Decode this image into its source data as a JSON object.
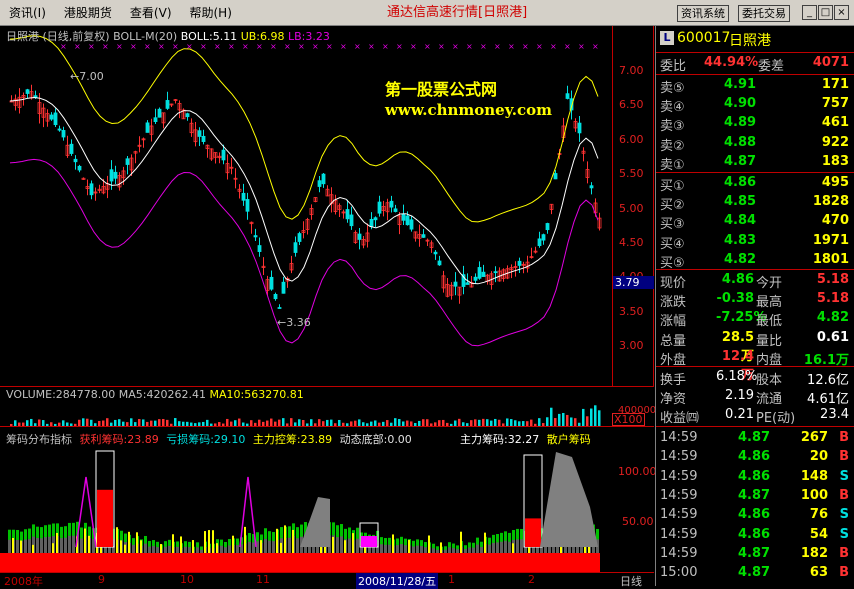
{
  "menu": [
    "资讯(I)",
    "港股期货",
    "查看(V)",
    "帮助(H)"
  ],
  "app_title": "通达信高速行情[日照港]",
  "sys_buttons": [
    "资讯系统",
    "委托交易"
  ],
  "window_buttons": [
    "_",
    "□",
    "×"
  ],
  "main_legend": {
    "name": "日照港",
    "mode": "(日线,前复权)",
    "indicator": "BOLL-M(20)",
    "boll": "BOLL:5.11",
    "ub": "UB:6.98",
    "lb": "LB:3.23"
  },
  "price_axis": [
    "7.00",
    "6.50",
    "6.00",
    "5.50",
    "5.00",
    "4.50",
    "4.00",
    "3.50",
    "3.00"
  ],
  "current_price_tag": "3.79",
  "annotations": {
    "high": "7.00",
    "low": "3.36"
  },
  "watermark": {
    "line1": "第一股票公式网",
    "line2": "www.chnmoney.com"
  },
  "vol_legend": {
    "vol": "VOLUME:284778.00",
    "ma5": "MA5:420262.41",
    "ma10": "MA10:563270.81"
  },
  "vol_axis": {
    "top": "400000",
    "unit": "X100"
  },
  "chip_legend": {
    "title": "筹码分布指标",
    "profit": "获利筹码:23.89",
    "loss": "亏损筹码:29.10",
    "control": "主力控筹:23.89",
    "bottom": "动态底部:0.00",
    "main": "主力筹码:32.27",
    "retail": "散户筹码"
  },
  "chip_axis": [
    "100.00",
    "50.00"
  ],
  "dates": [
    "2008年",
    "9",
    "10",
    "11",
    "2008/11/28/五",
    "1",
    "2"
  ],
  "period": "日线",
  "colors": {
    "up": "#ff3232",
    "down": "#00e0e0",
    "yellow": "#ffff00",
    "magenta": "#e000e0",
    "white": "#ffffff",
    "green": "#00e000",
    "axis_red": "#c00000"
  },
  "quote": {
    "code": "600017",
    "name": "日照港",
    "webi_label": "委比",
    "webi": "44.94%",
    "wecha_label": "委差",
    "wecha": "4071",
    "asks": [
      {
        "label": "卖⑤",
        "price": "4.91",
        "vol": "171"
      },
      {
        "label": "卖④",
        "price": "4.90",
        "vol": "757"
      },
      {
        "label": "卖③",
        "price": "4.89",
        "vol": "461"
      },
      {
        "label": "卖②",
        "price": "4.88",
        "vol": "922"
      },
      {
        "label": "卖①",
        "price": "4.87",
        "vol": "183"
      }
    ],
    "bids": [
      {
        "label": "买①",
        "price": "4.86",
        "vol": "495"
      },
      {
        "label": "买②",
        "price": "4.85",
        "vol": "1828"
      },
      {
        "label": "买③",
        "price": "4.84",
        "vol": "470"
      },
      {
        "label": "买④",
        "price": "4.83",
        "vol": "1971"
      },
      {
        "label": "买⑤",
        "price": "4.82",
        "vol": "1801"
      }
    ],
    "stats": [
      {
        "l1": "现价",
        "v1": "4.86",
        "l2": "今开",
        "v2": "5.18"
      },
      {
        "l1": "涨跌",
        "v1": "-0.38",
        "l2": "最高",
        "v2": "5.18"
      },
      {
        "l1": "涨幅",
        "v1": "-7.25%",
        "l2": "最低",
        "v2": "4.82"
      },
      {
        "l1": "总量",
        "v1": "28.5万",
        "l2": "量比",
        "v2": "0.61"
      },
      {
        "l1": "外盘",
        "v1": "12.4万",
        "l2": "内盘",
        "v2": "16.1万"
      }
    ],
    "stats2": [
      {
        "l1": "换手",
        "v1": "6.18%",
        "l2": "股本",
        "v2": "12.6亿"
      },
      {
        "l1": "净资",
        "v1": "2.19",
        "l2": "流通",
        "v2": "4.61亿"
      },
      {
        "l1": "收益㈣",
        "v1": "0.21",
        "l2": "PE(动)",
        "v2": "23.4"
      }
    ],
    "ticks": [
      {
        "time": "14:59",
        "price": "4.87",
        "vol": "267",
        "bs": "B"
      },
      {
        "time": "14:59",
        "price": "4.86",
        "vol": "20",
        "bs": "B"
      },
      {
        "time": "14:59",
        "price": "4.86",
        "vol": "148",
        "bs": "S"
      },
      {
        "time": "14:59",
        "price": "4.87",
        "vol": "100",
        "bs": "B"
      },
      {
        "time": "14:59",
        "price": "4.86",
        "vol": "76",
        "bs": "S"
      },
      {
        "time": "14:59",
        "price": "4.86",
        "vol": "54",
        "bs": "S"
      },
      {
        "time": "14:59",
        "price": "4.87",
        "vol": "182",
        "bs": "B"
      },
      {
        "time": "15:00",
        "price": "4.87",
        "vol": "63",
        "bs": "B"
      }
    ]
  }
}
